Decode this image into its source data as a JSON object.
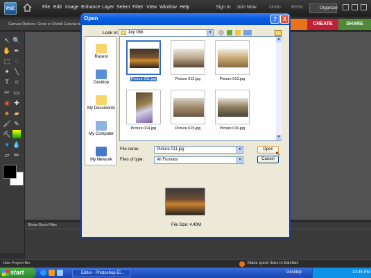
{
  "app": {
    "logo": "PSE",
    "menu": [
      "File",
      "Edit",
      "Image",
      "Enhance",
      "Layer",
      "Select",
      "Filter",
      "View",
      "Window",
      "Help"
    ],
    "right": {
      "signin": "Sign In",
      "join": "Join Now",
      "undo": "Undo",
      "redo": "Redo",
      "organizer": "Organizer"
    }
  },
  "options": {
    "label": "Canvas Options",
    "hint": "Grow or Shrink Canvas to"
  },
  "tabs": {
    "create": "CREATE",
    "share": "SHARE"
  },
  "bin": {
    "label": "Show Open Files"
  },
  "status": {
    "hide": "Hide Project Bin",
    "tip": "Make quick fixes in batches"
  },
  "taskbar": {
    "start": "start",
    "task": "Editor - Photoshop El...",
    "desktop": "Desktop",
    "clock": "10:45 PM"
  },
  "dialog": {
    "title": "Open",
    "look_in_label": "Look in:",
    "look_in_value": "July 08b",
    "places": [
      "Recent",
      "Desktop",
      "My Documents",
      "My Computer",
      "My Network"
    ],
    "files": [
      {
        "name": "Picture 011.jpg",
        "selected": true
      },
      {
        "name": "Picture 012.jpg"
      },
      {
        "name": "Picture 013.jpg"
      },
      {
        "name": "Picture 014.jpg"
      },
      {
        "name": "Picture 015.jpg"
      },
      {
        "name": "Picture 016.jpg"
      }
    ],
    "file_name_label": "File name:",
    "file_name_value": "Picture 011.jpg",
    "file_type_label": "Files of type:",
    "file_type_value": "All Formats",
    "open_label": "Open",
    "cancel_label": "Cancel",
    "file_size": "File Size: 4.40M",
    "help_btn": "?",
    "close_btn": "X"
  },
  "colors": {
    "titlebar": "#0a5fe0",
    "create": "#c0213a",
    "share": "#4f8a3a",
    "accent_orange": "#e8731a"
  }
}
